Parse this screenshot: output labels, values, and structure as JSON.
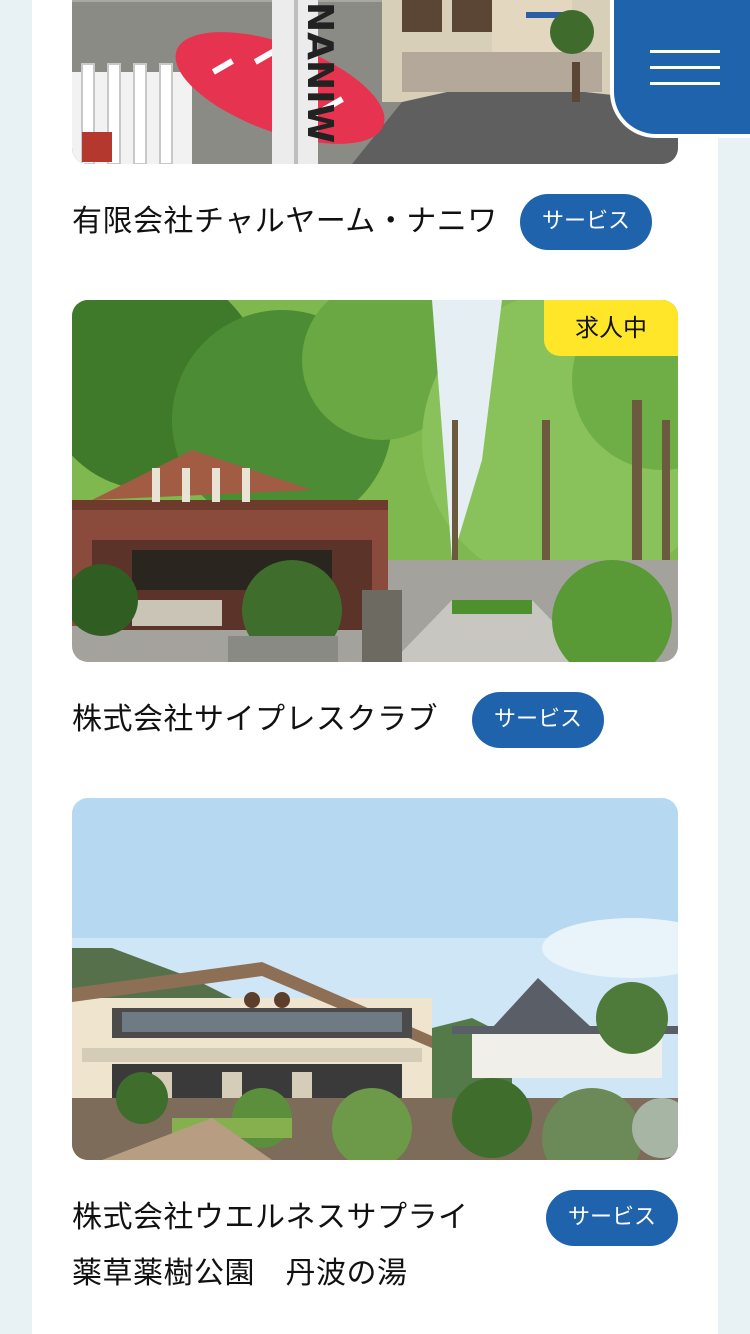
{
  "companies": [
    {
      "name": "有限会社チャルヤーム・ナニワ",
      "tag": "サービス",
      "photo_sign_text": "NANIW"
    },
    {
      "name": "株式会社サイプレスクラブ",
      "tag": "サービス",
      "badge": "求人中"
    },
    {
      "name_line1": "株式会社ウエルネスサプライ",
      "name_line2": "薬草薬樹公園　丹波の湯",
      "tag": "サービス"
    }
  ],
  "menu": {
    "icon": "hamburger-menu-icon"
  },
  "colors": {
    "accent": "#1f63ad",
    "badge": "#ffe628",
    "background": "#e8f1f3",
    "panel": "#ffffff",
    "text": "#111111"
  }
}
